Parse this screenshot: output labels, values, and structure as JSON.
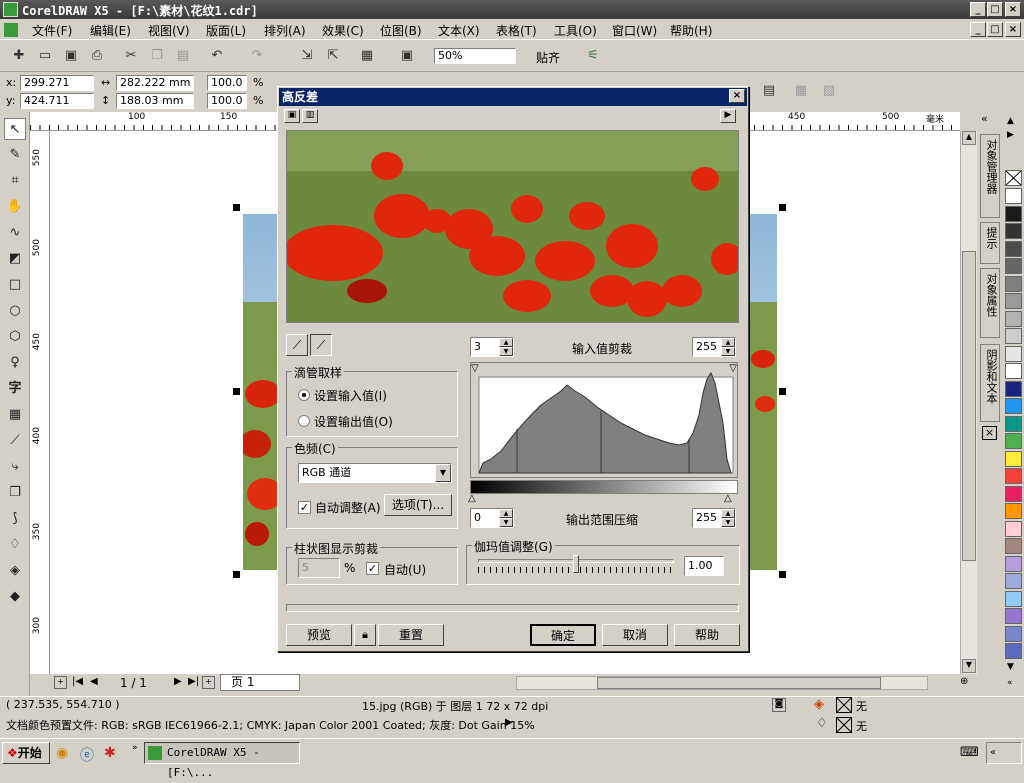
{
  "window": {
    "title": "CorelDRAW X5 - [F:\\素材\\花纹1.cdr]"
  },
  "menu": [
    "文件(F)",
    "编辑(E)",
    "视图(V)",
    "版面(L)",
    "排列(A)",
    "效果(C)",
    "位图(B)",
    "文本(X)",
    "表格(T)",
    "工具(O)",
    "窗口(W)",
    "帮助(H)"
  ],
  "toolbar": {
    "zoom": "50%",
    "snap_label": "贴齐"
  },
  "property_bar": {
    "x_label": "x:",
    "x_value": "299.271 mm",
    "y_label": "y:",
    "y_value": "424.711 mm",
    "w_value": "282.222 mm",
    "h_value": "188.03 mm",
    "scale_x": "100.0",
    "scale_y": "100.0",
    "percent": "%"
  },
  "ruler_h": [
    "100",
    "150",
    "450",
    "500",
    "毫米"
  ],
  "ruler_v": [
    "550",
    "500",
    "450",
    "400",
    "350",
    "300"
  ],
  "dialog": {
    "title": "高反差",
    "eyedropper_group": "滴管取样",
    "radio_input": "设置输入值(I)",
    "radio_output": "设置输出值(O)",
    "channel_group": "色频(C)",
    "channel_value": "RGB 通道",
    "auto_adjust": "自动调整(A)",
    "options_button": "选项(T)...",
    "histogram_clip_group": "柱状图显示剪裁",
    "clip_value": "5",
    "clip_unit": "%",
    "auto_label": "自动(U)",
    "input_clip_label": "输入值剪裁",
    "input_low": "3",
    "input_high": "255",
    "output_label": "输出范围压缩",
    "output_low": "0",
    "output_high": "255",
    "gamma_label": "伽玛值调整(G)",
    "gamma_value": "1.00",
    "preview_button": "预览",
    "reset_button": "重置",
    "ok_button": "确定",
    "cancel_button": "取消",
    "help_button": "帮助"
  },
  "pages": {
    "counter": "1 / 1",
    "tab": "页 1"
  },
  "status": {
    "coords": "( 237.535, 554.710 )",
    "info": "15.jpg (RGB) 于 图层 1 72 x 72 dpi",
    "profile": "文档颜色预置文件: RGB: sRGB IEC61966-2.1; CMYK: Japan Color 2001 Coated; 灰度: Dot Gain 15%",
    "fill_none": "无",
    "outline_none": "无"
  },
  "dockers": [
    "对象管理器",
    "提示",
    "对象属性",
    "阴影和文本"
  ],
  "taskbar": {
    "start": "开始",
    "task": "CorelDRAW X5 - [F:\\..."
  },
  "palette_colors": [
    "#ffffff",
    "#1a1a1a",
    "#333333",
    "#4d4d4d",
    "#666666",
    "#808080",
    "#999999",
    "#b3b3b3",
    "#cccccc",
    "#e6e6e6",
    "#ffffff",
    "#1a237e",
    "#2196f3",
    "#009688",
    "#4caf50",
    "#ffeb3b",
    "#f44336",
    "#e91e63",
    "#ff9800",
    "#ffcdd2",
    "#a1887f",
    "#b39ddb",
    "#9fa8da",
    "#90caf9",
    "#9575cd",
    "#7986cb",
    "#5c6bc0"
  ]
}
